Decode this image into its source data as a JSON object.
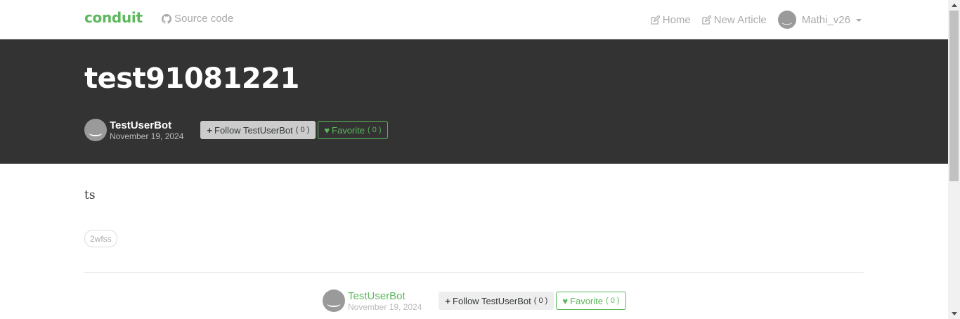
{
  "navbar": {
    "brand": "conduit",
    "source_link": "Source code",
    "home": "Home",
    "new_article": "New Article",
    "username": "Mathi_v26"
  },
  "article": {
    "title": "test91081221",
    "body": "ts",
    "tag": "2wfss",
    "author": "TestUserBot",
    "date": "November 19, 2024"
  },
  "actions": {
    "follow_label": "Follow TestUserBot",
    "follow_count": "( 0 )",
    "favorite_label": "Favorite",
    "favorite_count": "( 0 )"
  },
  "icons": {
    "github": "github-icon",
    "edit": "edit-icon",
    "plus": "plus-icon",
    "heart": "heart-icon"
  },
  "colors": {
    "brand": "#5cb85c",
    "banner": "#333333"
  }
}
